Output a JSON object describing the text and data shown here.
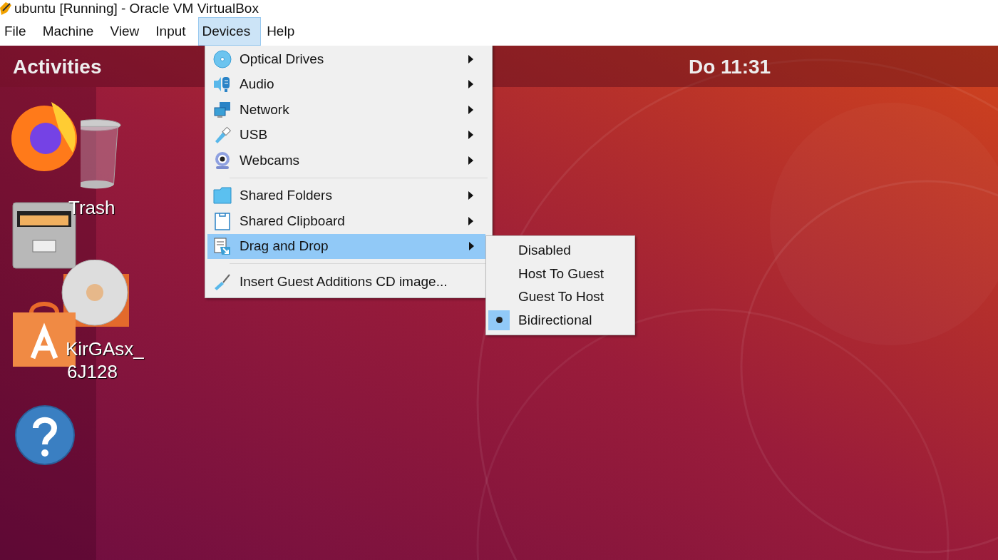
{
  "window": {
    "title": "ubuntu [Running] - Oracle VM VirtualBox"
  },
  "menubar": [
    {
      "label": "File",
      "selected": false
    },
    {
      "label": "Machine",
      "selected": false
    },
    {
      "label": "View",
      "selected": false
    },
    {
      "label": "Input",
      "selected": false
    },
    {
      "label": "Devices",
      "selected": true
    },
    {
      "label": "Help",
      "selected": false
    }
  ],
  "guest": {
    "topbar": {
      "activities": "Activities",
      "clock": "Do 11:31"
    },
    "desktop_icons": [
      {
        "kind": "trash",
        "label": "Trash"
      },
      {
        "kind": "disc",
        "label": "KirGAsx_"
      },
      {
        "kind": "disc_line2",
        "label": "6J128"
      }
    ]
  },
  "devices_menu": {
    "groups": [
      [
        {
          "kind": "disc",
          "label": "Optical Drives",
          "highlighted": false
        },
        {
          "kind": "audio",
          "label": "Audio",
          "highlighted": false
        },
        {
          "kind": "network",
          "label": "Network",
          "highlighted": false
        },
        {
          "kind": "usb",
          "label": "USB",
          "highlighted": false
        },
        {
          "kind": "webcam",
          "label": "Webcams",
          "highlighted": false
        }
      ],
      [
        {
          "kind": "folder",
          "label": "Shared Folders",
          "highlighted": false
        },
        {
          "kind": "clipboard",
          "label": "Shared Clipboard",
          "highlighted": false
        },
        {
          "kind": "dragdrop",
          "label": "Drag and Drop",
          "highlighted": true
        }
      ],
      [
        {
          "kind": "wrench",
          "label": "Insert Guest Additions CD image...",
          "highlighted": false,
          "submenu": false
        }
      ]
    ]
  },
  "drag_and_drop_menu": [
    {
      "label": "Disabled",
      "selected": false
    },
    {
      "label": "Host To Guest",
      "selected": false
    },
    {
      "label": "Guest To Host",
      "selected": false
    },
    {
      "label": "Bidirectional",
      "selected": true
    }
  ]
}
